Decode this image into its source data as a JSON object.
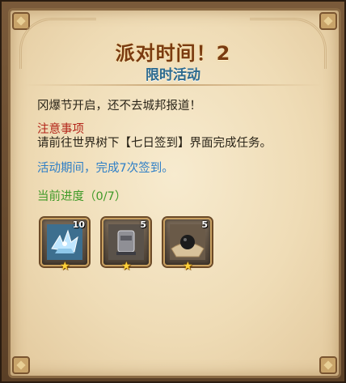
{
  "dialog": {
    "title": "派对时间！2",
    "subtitle": "限时活动",
    "intro": "冈爆节开启，还不去城邦报道！",
    "notice_title": "注意事项",
    "notice_body": "请前往世界树下【七日签到】界面完成任务。",
    "period": "活动期间，完成7次签到。",
    "progress": "当前进度（0/7）"
  },
  "colors": {
    "title": "#7a3b10",
    "subtitle": "#2c6a8e",
    "notice": "#b3261a",
    "period": "#2f7fc7",
    "progress": "#3f9a28",
    "parchment": "#efdcb6"
  },
  "rewards": [
    {
      "icon": "crystal-wings-icon",
      "count": "10",
      "stars": "★"
    },
    {
      "icon": "anvil-canister-icon",
      "count": "5",
      "stars": "★"
    },
    {
      "icon": "black-orb-icon",
      "count": "5",
      "stars": "★"
    }
  ]
}
